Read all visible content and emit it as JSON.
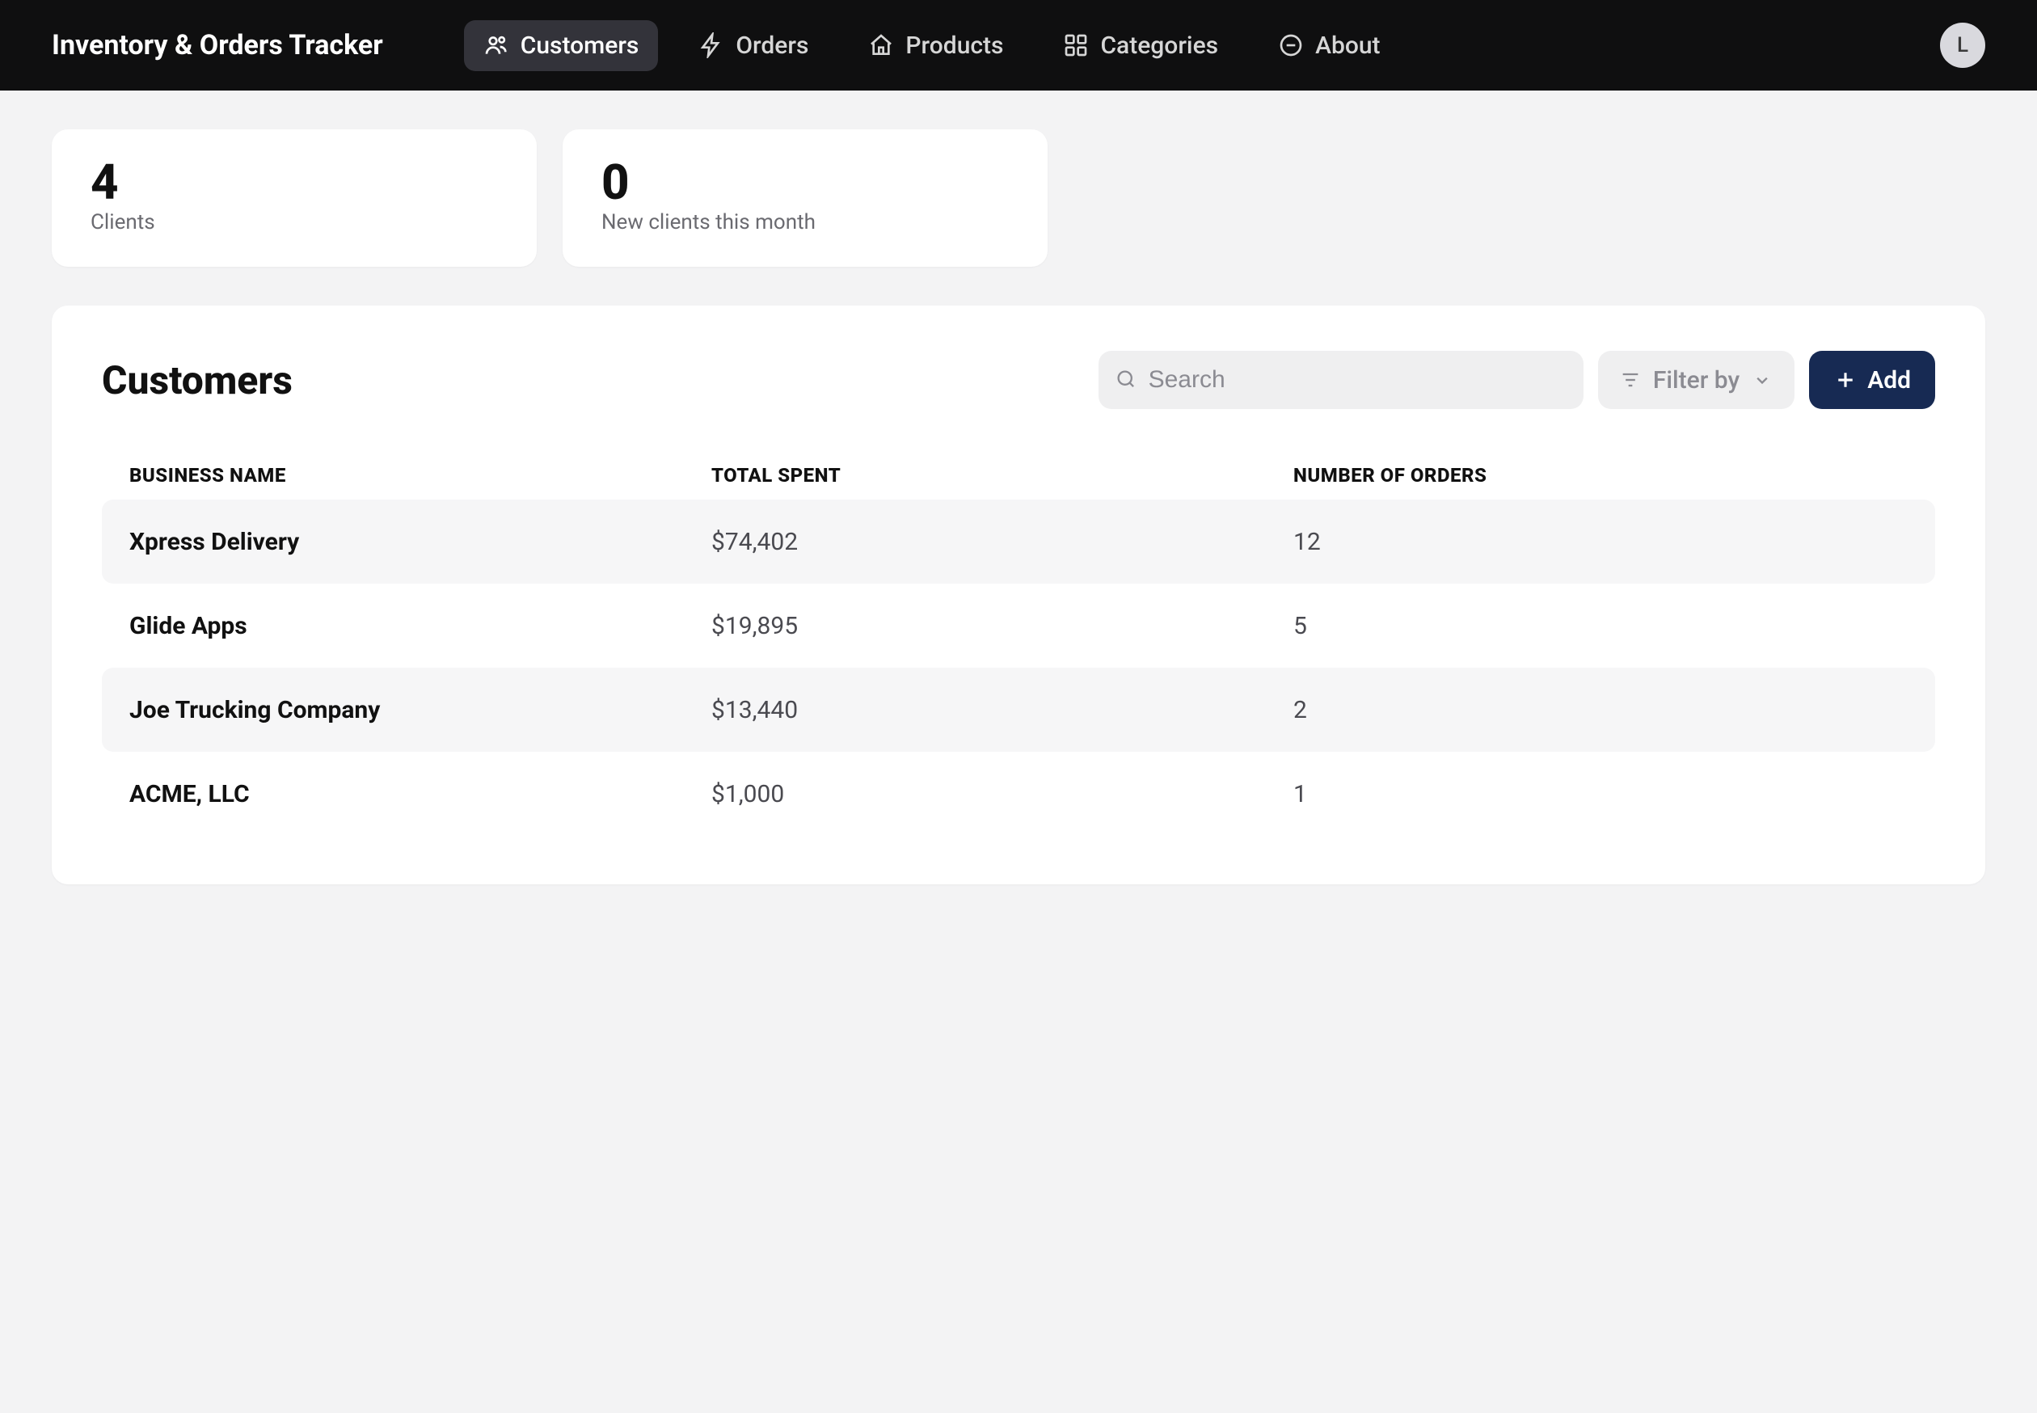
{
  "app_title": "Inventory & Orders Tracker",
  "nav": {
    "tabs": [
      {
        "label": "Customers",
        "icon": "people-icon",
        "active": true
      },
      {
        "label": "Orders",
        "icon": "bolt-icon",
        "active": false
      },
      {
        "label": "Products",
        "icon": "home-icon",
        "active": false
      },
      {
        "label": "Categories",
        "icon": "grid-icon",
        "active": false
      },
      {
        "label": "About",
        "icon": "smile-icon",
        "active": false
      }
    ],
    "avatar_initial": "L"
  },
  "stats": [
    {
      "value": "4",
      "label": "Clients"
    },
    {
      "value": "0",
      "label": "New clients this month"
    }
  ],
  "panel": {
    "title": "Customers",
    "search_placeholder": "Search",
    "filter_label": "Filter by",
    "add_label": "Add"
  },
  "table": {
    "columns": [
      "BUSINESS NAME",
      "TOTAL SPENT",
      "NUMBER OF ORDERS"
    ],
    "rows": [
      {
        "name": "Xpress Delivery",
        "spent": "$74,402",
        "orders": "12"
      },
      {
        "name": "Glide Apps",
        "spent": "$19,895",
        "orders": "5"
      },
      {
        "name": "Joe Trucking Company",
        "spent": "$13,440",
        "orders": "2"
      },
      {
        "name": "ACME, LLC",
        "spent": "$1,000",
        "orders": "1"
      }
    ]
  }
}
